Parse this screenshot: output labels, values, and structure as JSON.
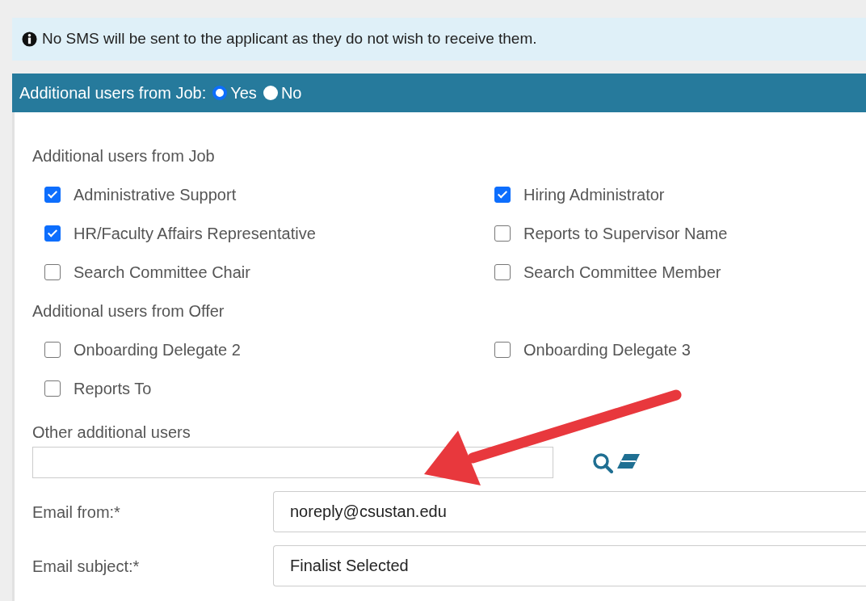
{
  "alert": {
    "text": "No SMS will be sent to the applicant as they do not wish to receive them."
  },
  "header": {
    "label": "Additional users from Job:",
    "options": [
      {
        "label": "Yes",
        "selected": true
      },
      {
        "label": "No",
        "selected": false
      }
    ]
  },
  "groups": [
    {
      "title": "Additional users from Job",
      "items": [
        {
          "label": "Administrative Support",
          "checked": true
        },
        {
          "label": "Hiring Administrator",
          "checked": true
        },
        {
          "label": "HR/Faculty Affairs Representative",
          "checked": true
        },
        {
          "label": "Reports to Supervisor Name",
          "checked": false
        },
        {
          "label": "Search Committee Chair",
          "checked": false
        },
        {
          "label": "Search Committee Member",
          "checked": false
        }
      ]
    },
    {
      "title": "Additional users from Offer",
      "items": [
        {
          "label": "Onboarding Delegate 2",
          "checked": false
        },
        {
          "label": "Onboarding Delegate 3",
          "checked": false
        },
        {
          "label": "Reports To",
          "checked": false
        }
      ]
    }
  ],
  "other_users": {
    "label": "Other additional users"
  },
  "fields": [
    {
      "label": "Email from:*",
      "value": "noreply@csustan.edu"
    },
    {
      "label": "Email subject:*",
      "value": "Finalist Selected"
    }
  ]
}
